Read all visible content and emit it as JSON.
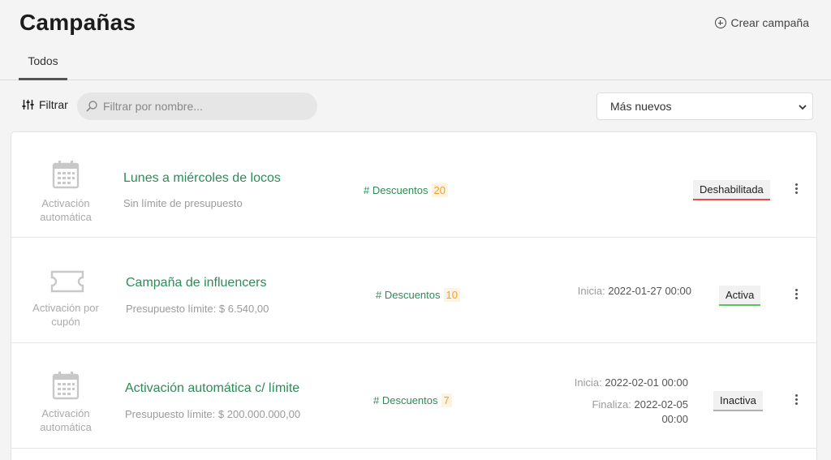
{
  "header": {
    "title": "Campañas",
    "create_label": "Crear campaña"
  },
  "tabs": [
    {
      "label": "Todos",
      "active": true
    }
  ],
  "toolbar": {
    "filter_label": "Filtrar",
    "search_placeholder": "Filtrar por nombre...",
    "sort_selected": "Más nuevos"
  },
  "colors": {
    "accent_green": "#2e8b57",
    "count_orange": "#f0a030",
    "status_disabled": "#e84a4a",
    "status_active": "#5cc55c",
    "status_inactive": "#b0b0b0"
  },
  "campaigns": [
    {
      "type_icon": "calendar-icon",
      "type_label_1": "Activación",
      "type_label_2": "automática",
      "name": "Lunes a miércoles de locos",
      "budget": "Sin límite de presupuesto",
      "discounts_label": "# Descuentos",
      "discounts_count": "20",
      "status": "Deshabilitada"
    },
    {
      "type_icon": "ticket-icon",
      "type_label_1": "Activación por",
      "type_label_2": "cupón",
      "name": "Campaña de influencers",
      "budget": "Presupuesto límite: $ 6.540,00",
      "discounts_label": "# Descuentos",
      "discounts_count": "10",
      "start_label": "Inicia:",
      "start_value": "2022-01-27 00:00",
      "status": "Activa"
    },
    {
      "type_icon": "calendar-icon",
      "type_label_1": "Activación",
      "type_label_2": "automática",
      "name": "Activación automática c/ límite",
      "budget": "Presupuesto límite: $ 200.000.000,00",
      "discounts_label": "# Descuentos",
      "discounts_count": "7",
      "start_label": "Inicia:",
      "start_value": "2022-02-01 00:00",
      "end_label": "Finaliza:",
      "end_value_1": "2022-02-05",
      "end_value_2": "00:00",
      "status": "Inactiva"
    }
  ]
}
